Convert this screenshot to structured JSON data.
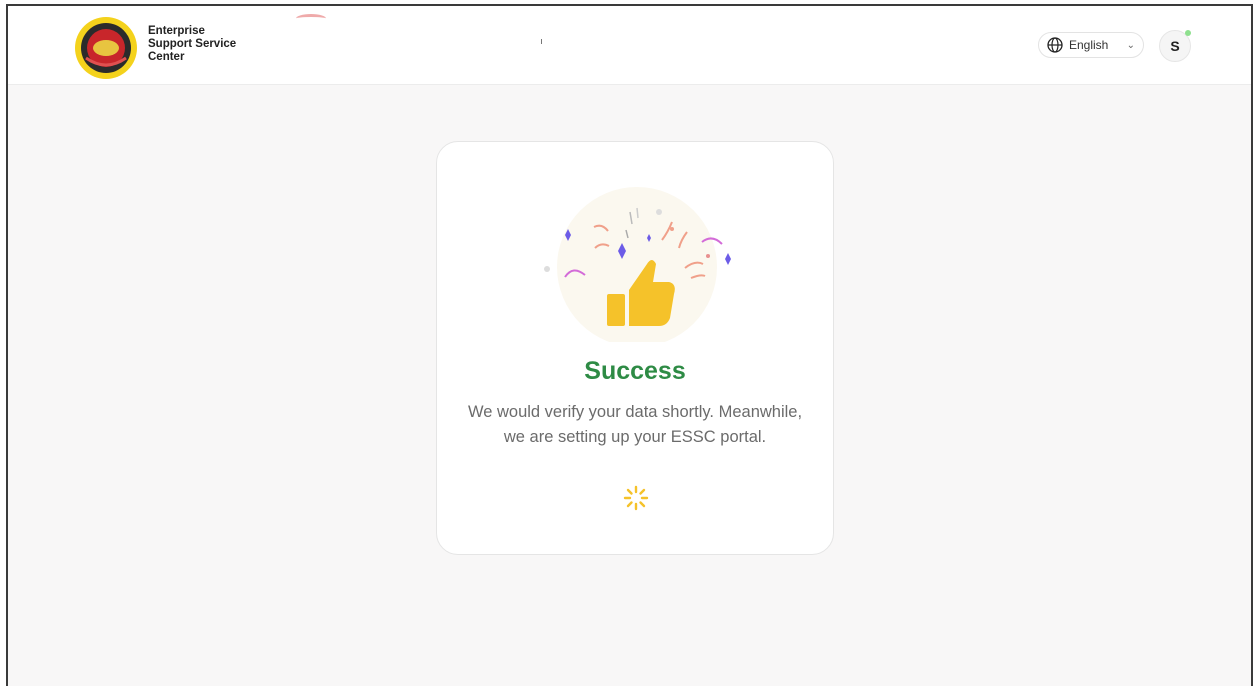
{
  "header": {
    "brand_lines": [
      "Enterprise",
      "Support Service",
      "Center"
    ],
    "language": {
      "label": "English"
    },
    "user": {
      "initial": "S"
    }
  },
  "card": {
    "title": "Success",
    "message": "We would verify your data shortly. Meanwhile, we are setting up your ESSC portal."
  },
  "colors": {
    "success": "#2e8b45",
    "accent_yellow": "#f5c22a",
    "sparkle_purple": "#6c5ce7",
    "confetti_pink": "#d36bd8",
    "presence_green": "#8ee08e"
  },
  "icons": [
    "logo",
    "globe-icon",
    "chevron-down-icon",
    "thumbs-up-icon",
    "loading-spinner-icon"
  ]
}
